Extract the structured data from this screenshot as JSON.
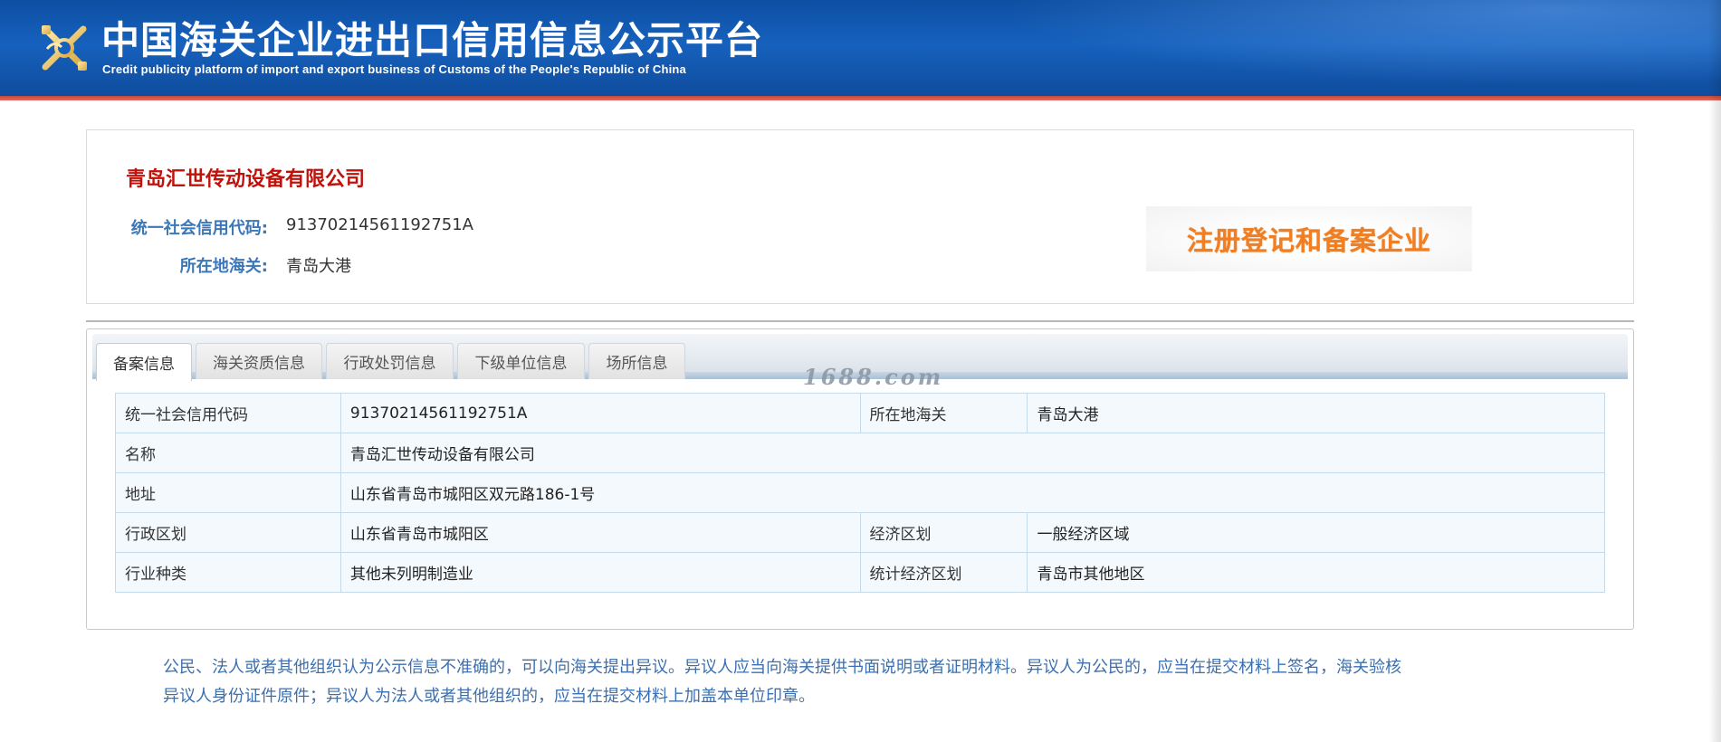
{
  "header": {
    "title": "中国海关企业进出口信用信息公示平台",
    "subtitle": "Credit publicity platform of import and export business of Customs of the People's Republic of China",
    "logo_icon": "customs-emblem-icon"
  },
  "company": {
    "name": "青岛汇世传动设备有限公司",
    "credit_code_label": "统一社会信用代码:",
    "credit_code": "91370214561192751A",
    "customs_label": "所在地海关:",
    "customs": "青岛大港",
    "badge": "注册登记和备案企业"
  },
  "tabs": [
    {
      "label": "备案信息",
      "active": true
    },
    {
      "label": "海关资质信息",
      "active": false
    },
    {
      "label": "行政处罚信息",
      "active": false
    },
    {
      "label": "下级单位信息",
      "active": false
    },
    {
      "label": "场所信息",
      "active": false
    }
  ],
  "watermark": "1688.com",
  "details": {
    "row1": {
      "k1": "统一社会信用代码",
      "v1": "91370214561192751A",
      "k2": "所在地海关",
      "v2": "青岛大港"
    },
    "row2": {
      "k1": "名称",
      "v1": "青岛汇世传动设备有限公司"
    },
    "row3": {
      "k1": "地址",
      "v1": "山东省青岛市城阳区双元路186-1号"
    },
    "row4": {
      "k1": "行政区划",
      "v1": "山东省青岛市城阳区",
      "k2": "经济区划",
      "v2": "一般经济区域"
    },
    "row5": {
      "k1": "行业种类",
      "v1": "其他未列明制造业",
      "k2": "统计经济区划",
      "v2": "青岛市其他地区"
    }
  },
  "notice": {
    "line1": "公民、法人或者其他组织认为公示信息不准确的，可以向海关提出异议。异议人应当向海关提供书面说明或者证明材料。异议人为公民的，应当在提交材料上签名，海关验核",
    "line2": "异议人身份证件原件；异议人为法人或者其他组织的，应当在提交材料上加盖本单位印章。"
  },
  "colors": {
    "header_blue": "#1661bd",
    "company_name_red": "#c0120b",
    "label_blue": "#3c77b8",
    "badge_orange": "#f07e22",
    "notice_blue": "#3b6fb0"
  }
}
